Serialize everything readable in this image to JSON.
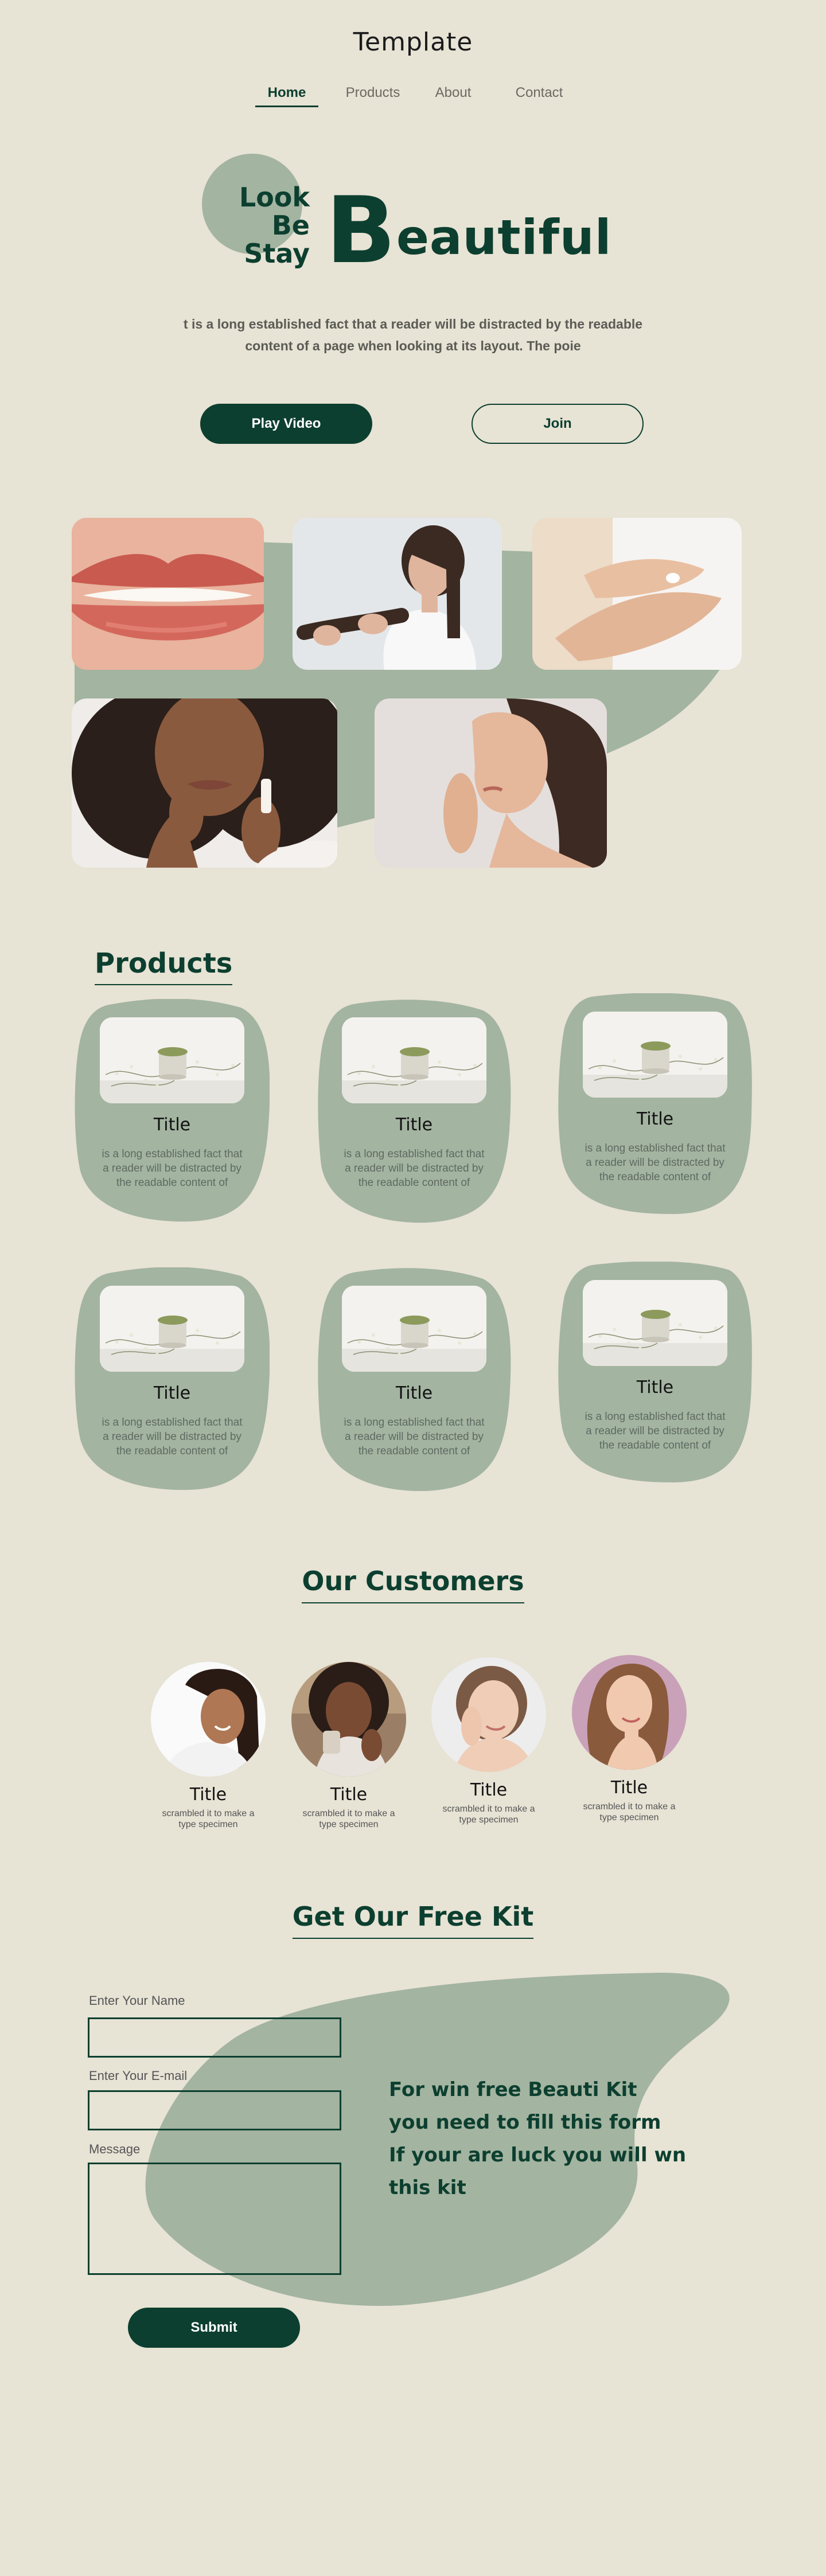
{
  "header": {
    "title": "Template",
    "nav": [
      {
        "label": "Home",
        "active": true
      },
      {
        "label": "Products",
        "active": false
      },
      {
        "label": "About",
        "active": false
      },
      {
        "label": "Contact",
        "active": false
      }
    ]
  },
  "hero": {
    "look_lines": [
      "Look",
      "Be",
      "Stay"
    ],
    "beautiful_initial": "B",
    "beautiful_rest": "eautiful",
    "description_line1": "t is a long established fact that a reader will be distracted by the readable",
    "description_line2": "content of a page when looking at its layout. The poie",
    "play_label": "Play Video",
    "join_label": "Join"
  },
  "gallery": {
    "photos": [
      "lips-photo",
      "hair-care-photo",
      "hand-cream-photo",
      "lip-balm-photo",
      "lip-touch-photo"
    ]
  },
  "products": {
    "heading": "Products",
    "items": [
      {
        "title": "Title",
        "desc1": "is a long established fact that",
        "desc2": "a reader will be distracted by",
        "desc3": "the readable content of"
      },
      {
        "title": "Title",
        "desc1": "is a long established fact that",
        "desc2": "a reader will be distracted by",
        "desc3": "the readable content of"
      },
      {
        "title": "Title",
        "desc1": "is a long established fact that",
        "desc2": "a reader will be distracted by",
        "desc3": "the readable content of"
      },
      {
        "title": "Title",
        "desc1": "is a long established fact that",
        "desc2": "a reader will be distracted by",
        "desc3": "the readable content of"
      },
      {
        "title": "Title",
        "desc1": "is a long established fact that",
        "desc2": "a reader will be distracted by",
        "desc3": "the readable content of"
      },
      {
        "title": "Title",
        "desc1": "is a long established fact that",
        "desc2": "a reader will be distracted by",
        "desc3": "the readable content of"
      }
    ]
  },
  "customers": {
    "heading": "Our Customers",
    "items": [
      {
        "title": "Title",
        "desc1": "scrambled it to make a",
        "desc2": "type specimen"
      },
      {
        "title": "Title",
        "desc1": "scrambled it to make a",
        "desc2": "type specimen"
      },
      {
        "title": "Title",
        "desc1": "scrambled it to make a",
        "desc2": "type specimen"
      },
      {
        "title": "Title",
        "desc1": "scrambled it to make a",
        "desc2": "type specimen"
      }
    ]
  },
  "kit": {
    "heading": "Get Our Free Kit",
    "name_label": "Enter Your Name",
    "name_value": "",
    "email_label": "Enter Your E-mail",
    "email_value": "",
    "message_label": "Message",
    "message_value": "",
    "submit_label": "Submit",
    "promo_lines": [
      "For  win free Beauti Kit",
      "you need to fill this form",
      "If your are luck you will wn",
      "this kit"
    ]
  },
  "colors": {
    "background": "#e7e3d5",
    "primary": "#0c3f2f",
    "sage": "#a3b4a1"
  }
}
